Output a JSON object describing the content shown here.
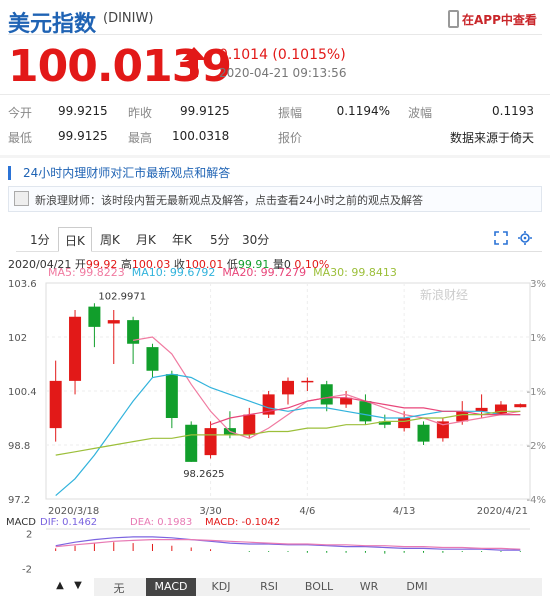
{
  "header": {
    "title": "美元指数",
    "code": "(DINIW)",
    "app_link": "在APP中查看"
  },
  "quote": {
    "price": "100.0139",
    "change": "0.1014 (0.1015%)",
    "time": "2020-04-21 09:13:56"
  },
  "stats": [
    {
      "label": "今开",
      "value": "99.9215"
    },
    {
      "label": "昨收",
      "value": "99.9125"
    },
    {
      "label": "振幅",
      "value": "0.1194%"
    },
    {
      "label": "波幅",
      "value": "0.1193"
    },
    {
      "label": "最低",
      "value": "99.9125"
    },
    {
      "label": "最高",
      "value": "100.0318"
    },
    {
      "label": "报价",
      "value": "数据来源于倚天"
    }
  ],
  "advisor": {
    "title": "24小时内理财师对汇市最新观点和解答",
    "message": "新浪理财师：该时段内暂无最新观点及解答，点击查看24小时之前的观点及解答"
  },
  "tabs": [
    "1分",
    "日K",
    "周K",
    "月K",
    "年K",
    "5分",
    "30分"
  ],
  "active_tab": "日K",
  "chart_info": {
    "date": "2020/04/21",
    "open_label": "开",
    "open": "99.92",
    "high_label": "高",
    "high": "100.03",
    "close_label": "收",
    "close": "100.01",
    "low_label": "低",
    "low": "99.91",
    "volume_label": "量",
    "volume": "0",
    "pct": "0.10%",
    "ma5": "MA5: 99.8223",
    "ma10": "MA10: 99.6792",
    "ma20": "MA20: 99.7279",
    "ma30": "MA30: 99.8413"
  },
  "watermark": "新浪财经",
  "macd": {
    "label": "MACD",
    "dif": "DIF: 0.1462",
    "dea": "DEA: 0.1983",
    "macd": "MACD: -0.1042",
    "ticks": [
      "2",
      "-2"
    ]
  },
  "bottom_tabs": [
    "无",
    "MACD",
    "KDJ",
    "RSI",
    "BOLL",
    "WR",
    "DMI"
  ],
  "active_bottom_tab": "MACD",
  "colors": {
    "up": "#e21918",
    "down": "#119e2b",
    "ma5": "#f07aa0",
    "ma10": "#32b3dc",
    "ma20": "#e8467a",
    "ma30": "#9cbf3a",
    "dif": "#7b64e0",
    "dea": "#e87ab4"
  },
  "chart_data": {
    "type": "candlestick",
    "y_ticks": [
      "103.6",
      "102",
      "100.4",
      "98.8",
      "97.2"
    ],
    "ylim": [
      97.2,
      103.6
    ],
    "pct_ticks": [
      "3%",
      "1%",
      "-1%",
      "-2%",
      "-4%"
    ],
    "x_ticks": [
      "2020/3/18",
      "3/30",
      "4/6",
      "4/13",
      "2020/4/21"
    ],
    "high_annotation": "102.9971",
    "low_annotation": "98.2625",
    "candles": [
      {
        "o": 99.3,
        "c": 100.7,
        "h": 101.3,
        "l": 98.9
      },
      {
        "o": 100.7,
        "c": 102.6,
        "h": 102.8,
        "l": 100.3
      },
      {
        "o": 102.9,
        "c": 102.3,
        "h": 103.0,
        "l": 101.7
      },
      {
        "o": 102.4,
        "c": 102.5,
        "h": 102.8,
        "l": 101.2
      },
      {
        "o": 102.5,
        "c": 101.8,
        "h": 102.6,
        "l": 101.2
      },
      {
        "o": 101.7,
        "c": 101.0,
        "h": 101.8,
        "l": 100.8
      },
      {
        "o": 100.9,
        "c": 99.6,
        "h": 101.0,
        "l": 99.3
      },
      {
        "o": 99.4,
        "c": 98.3,
        "h": 99.5,
        "l": 98.3
      },
      {
        "o": 98.5,
        "c": 99.3,
        "h": 99.5,
        "l": 98.4
      },
      {
        "o": 99.3,
        "c": 99.1,
        "h": 99.8,
        "l": 99.0
      },
      {
        "o": 99.1,
        "c": 99.7,
        "h": 99.9,
        "l": 99.0
      },
      {
        "o": 99.7,
        "c": 100.3,
        "h": 100.4,
        "l": 99.6
      },
      {
        "o": 100.3,
        "c": 100.7,
        "h": 100.8,
        "l": 100.0
      },
      {
        "o": 100.7,
        "c": 100.7,
        "h": 100.8,
        "l": 100.4
      },
      {
        "o": 100.6,
        "c": 100.0,
        "h": 100.7,
        "l": 99.8
      },
      {
        "o": 100.0,
        "c": 100.2,
        "h": 100.4,
        "l": 99.9
      },
      {
        "o": 100.1,
        "c": 99.5,
        "h": 100.3,
        "l": 99.4
      },
      {
        "o": 99.5,
        "c": 99.4,
        "h": 99.7,
        "l": 99.3
      },
      {
        "o": 99.3,
        "c": 99.6,
        "h": 99.8,
        "l": 99.2
      },
      {
        "o": 99.4,
        "c": 98.9,
        "h": 99.5,
        "l": 98.8
      },
      {
        "o": 99.0,
        "c": 99.5,
        "h": 99.6,
        "l": 98.9
      },
      {
        "o": 99.5,
        "c": 99.8,
        "h": 100.1,
        "l": 99.4
      },
      {
        "o": 99.8,
        "c": 99.9,
        "h": 100.3,
        "l": 99.6
      },
      {
        "o": 99.7,
        "c": 100.0,
        "h": 100.1,
        "l": 99.7
      },
      {
        "o": 99.92,
        "c": 100.01,
        "h": 100.03,
        "l": 99.91
      }
    ],
    "ma": [
      {
        "name": "MA5",
        "values": [
          null,
          null,
          null,
          null,
          101.9,
          102.0,
          101.5,
          100.6,
          99.8,
          99.2,
          99.0,
          99.3,
          99.7,
          100.1,
          100.2,
          100.3,
          100.1,
          99.9,
          99.7,
          99.6,
          99.4,
          99.5,
          99.6,
          99.7,
          99.8
        ]
      },
      {
        "name": "MA10",
        "values": [
          97.3,
          97.8,
          98.5,
          99.3,
          100.1,
          100.8,
          100.9,
          100.8,
          100.5,
          100.3,
          100.1,
          99.9,
          99.8,
          99.9,
          99.9,
          99.8,
          99.7,
          99.6,
          99.6,
          99.7,
          99.8,
          99.8,
          99.8,
          99.7,
          99.7
        ]
      },
      {
        "name": "MA20",
        "values": [
          null,
          null,
          null,
          null,
          null,
          null,
          null,
          null,
          99.4,
          99.6,
          99.7,
          99.8,
          99.9,
          100.1,
          100.2,
          100.2,
          100.1,
          100.0,
          99.9,
          99.9,
          99.8,
          99.8,
          99.7,
          99.7,
          99.7
        ]
      },
      {
        "name": "MA30",
        "values": [
          98.5,
          98.6,
          98.7,
          98.8,
          98.9,
          99.0,
          99.0,
          99.1,
          99.1,
          99.1,
          99.1,
          99.2,
          99.2,
          99.3,
          99.3,
          99.4,
          99.4,
          99.5,
          99.5,
          99.6,
          99.6,
          99.7,
          99.7,
          99.8,
          99.8
        ]
      }
    ],
    "macd_hist": [
      0.3,
      0.6,
      0.9,
      1.0,
      0.9,
      0.8,
      0.6,
      0.4,
      0.2,
      0.0,
      -0.1,
      -0.1,
      -0.1,
      -0.2,
      -0.2,
      -0.2,
      -0.2,
      -0.3,
      -0.2,
      -0.2,
      -0.2,
      -0.1,
      -0.1,
      -0.1,
      -0.1
    ],
    "dif": [
      0.6,
      1.0,
      1.3,
      1.5,
      1.6,
      1.6,
      1.5,
      1.3,
      1.1,
      0.9,
      0.8,
      0.8,
      0.7,
      0.7,
      0.6,
      0.5,
      0.5,
      0.4,
      0.3,
      0.3,
      0.2,
      0.2,
      0.2,
      0.1,
      0.1
    ],
    "dea": [
      0.5,
      0.7,
      0.9,
      1.1,
      1.2,
      1.3,
      1.3,
      1.3,
      1.2,
      1.1,
      1.0,
      0.9,
      0.8,
      0.8,
      0.7,
      0.7,
      0.6,
      0.6,
      0.5,
      0.5,
      0.4,
      0.4,
      0.3,
      0.3,
      0.2
    ],
    "macd_ylim": [
      -2.5,
      2.5
    ]
  }
}
